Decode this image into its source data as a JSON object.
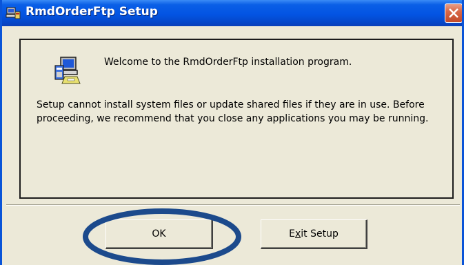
{
  "window": {
    "title": "RmdOrderFtp Setup",
    "close_icon": "close-icon",
    "app_icon": "setup-computer-icon",
    "accent_color": "#0354e3"
  },
  "content": {
    "icon": "setup-computer-icon",
    "welcome": "Welcome to the RmdOrderFtp installation program.",
    "warning": "Setup cannot install system files or update shared files if they are in use. Before proceeding, we recommend that you close any applications you may be running."
  },
  "buttons": {
    "ok_label": "OK",
    "exit_label_pre": "E",
    "exit_label_mnemonic": "x",
    "exit_label_post": "it Setup"
  },
  "annotation": {
    "highlight_color": "#1c4a8c"
  }
}
